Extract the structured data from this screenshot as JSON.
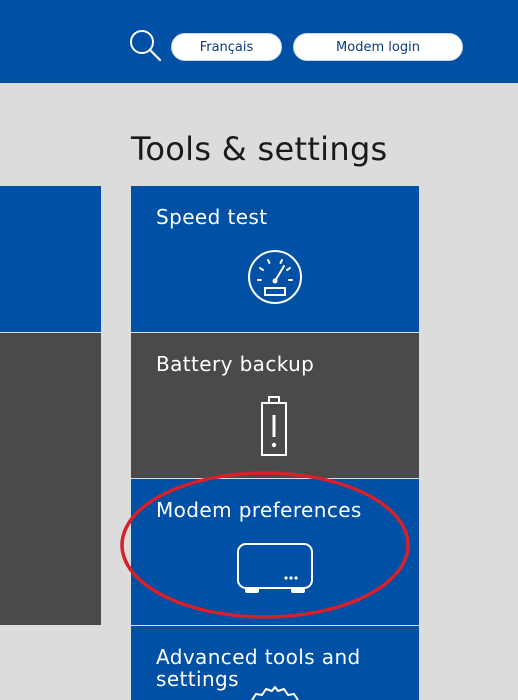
{
  "header": {
    "language_label": "Français",
    "login_label": "Modem login"
  },
  "main": {
    "title": "Tools & settings",
    "tiles": [
      {
        "label": "Speed test",
        "icon": "speedometer-icon"
      },
      {
        "label": "Battery backup",
        "icon": "battery-icon"
      },
      {
        "label": "Modem preferences",
        "icon": "modem-icon"
      },
      {
        "label_line1": "Advanced tools and",
        "label_line2": "settings",
        "icon": "gear-icon"
      }
    ]
  },
  "colors": {
    "brand_blue": "#0051a5",
    "tile_gray": "#4a4a4a",
    "page_bg": "#dcdcdc",
    "annotation_red": "#d8202a"
  }
}
